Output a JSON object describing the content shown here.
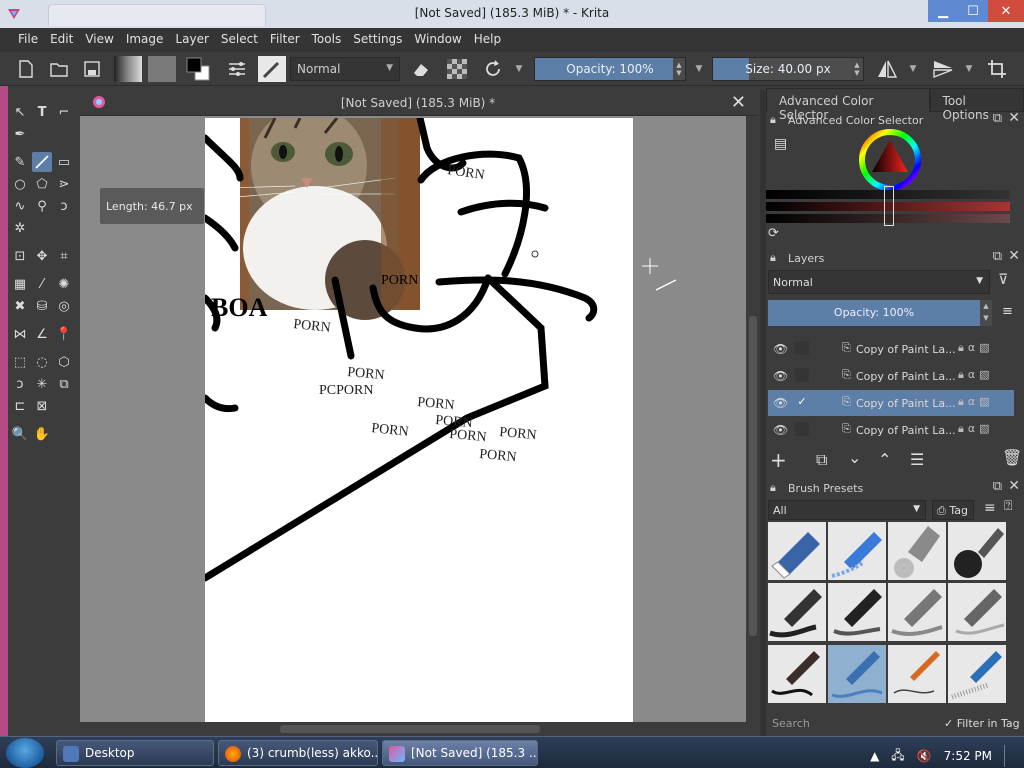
{
  "window": {
    "title": "[Not Saved]  (185.3 MiB) * - Krita"
  },
  "menu": [
    "File",
    "Edit",
    "View",
    "Image",
    "Layer",
    "Select",
    "Filter",
    "Tools",
    "Settings",
    "Window",
    "Help"
  ],
  "toolbar": {
    "blend_mode": "Normal",
    "opacity_label": "Opacity: 100%",
    "size_label": "Size: 40.00 px"
  },
  "document": {
    "tab_title": "[Not Saved]  (185.3 MiB) *",
    "tooltip": "Length: 46.7 px",
    "watermark_words": [
      "PORN",
      "PORN",
      "PORN",
      "PCPORN",
      "PORN",
      "PORN",
      "PORN",
      "PORN",
      "PORN",
      "PORN",
      "PORN"
    ]
  },
  "docker": {
    "tabs": [
      "Advanced Color Selector",
      "Tool Options"
    ],
    "color_selector_title": "Advanced Color Selector",
    "layers_title": "Layers",
    "layers_blend": "Normal",
    "layers_opacity": "Opacity:  100%",
    "layers": [
      {
        "name": "Copy of Paint La...",
        "selected": false,
        "checked": false
      },
      {
        "name": "Copy of Paint La...",
        "selected": false,
        "checked": false
      },
      {
        "name": "Copy of Paint La...",
        "selected": true,
        "checked": true
      },
      {
        "name": "Copy of Paint La...",
        "selected": false,
        "checked": false
      }
    ],
    "brush_presets_title": "Brush Presets",
    "brush_filter": "All",
    "tag_label": "Tag",
    "search_placeholder": "Search",
    "filter_in_tag": "Filter in Tag"
  },
  "taskbar": {
    "items": [
      "Desktop",
      "(3) crumb(less) akko...",
      "[Not Saved]  (185.3 ..."
    ],
    "clock": "7:52 PM"
  },
  "colors": {
    "accent": "#5d7fa7",
    "panel": "#3c3c3c",
    "canvas_bg": "#8a8a8a"
  }
}
